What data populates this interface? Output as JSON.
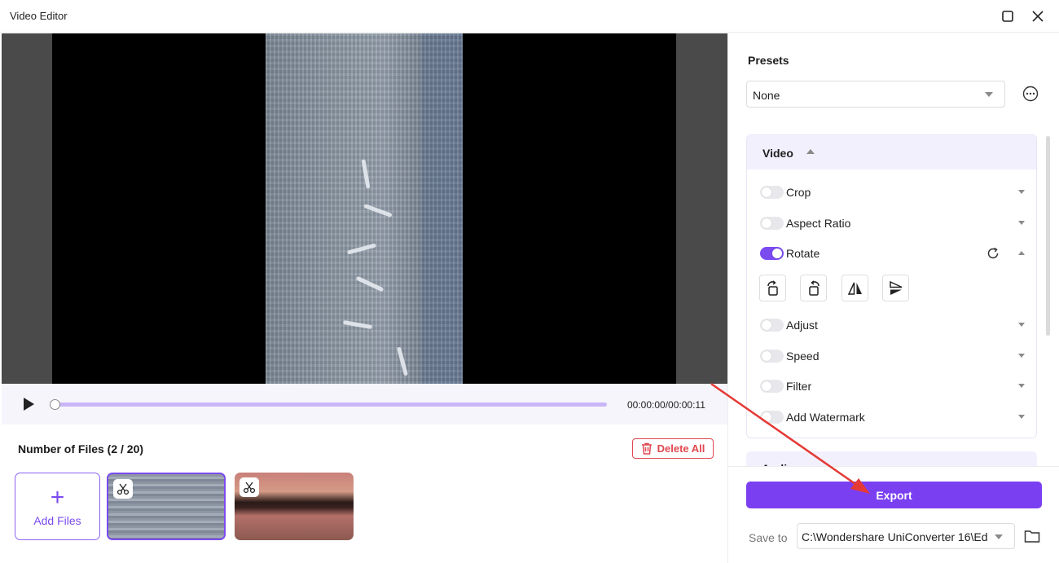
{
  "window": {
    "title": "Video Editor"
  },
  "player": {
    "timecode": "00:00:00/00:00:11",
    "progress": 0.0
  },
  "files": {
    "header": "Number of Files (2 / 20)",
    "delete_all": "Delete All",
    "add_files": "Add Files",
    "selected_index": 0
  },
  "presets": {
    "label": "Presets",
    "selected": "None"
  },
  "video_section": {
    "title": "Video",
    "options": [
      {
        "label": "Crop",
        "enabled": false
      },
      {
        "label": "Aspect Ratio",
        "enabled": false
      },
      {
        "label": "Rotate",
        "enabled": true
      },
      {
        "label": "Adjust",
        "enabled": false
      },
      {
        "label": "Speed",
        "enabled": false
      },
      {
        "label": "Filter",
        "enabled": false
      },
      {
        "label": "Add Watermark",
        "enabled": false
      }
    ]
  },
  "audio_section": {
    "title": "Audio"
  },
  "export": {
    "label": "Export",
    "save_to_label": "Save to",
    "save_to_path": "C:\\Wondershare UniConverter 16\\Ed"
  },
  "colors": {
    "accent": "#7b3ff2",
    "danger": "#e04850",
    "annotation_arrow": "#e53935"
  }
}
